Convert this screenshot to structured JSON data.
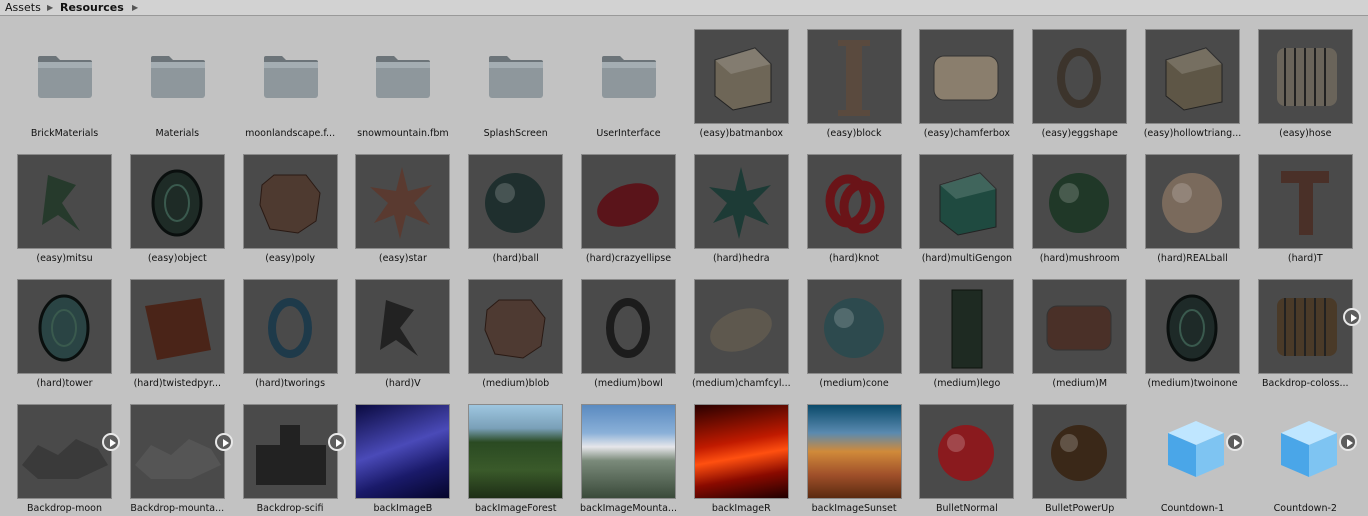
{
  "breadcrumb": {
    "root": "Assets",
    "current": "Resources"
  },
  "rows": [
    [
      {
        "label": "BrickMaterials",
        "kind": "folder"
      },
      {
        "label": "Materials",
        "kind": "folder"
      },
      {
        "label": "moonlandscape.f...",
        "kind": "folder"
      },
      {
        "label": "snowmountain.fbm",
        "kind": "folder"
      },
      {
        "label": "SplashScreen",
        "kind": "folder"
      },
      {
        "label": "UserInterface",
        "kind": "folder"
      },
      {
        "label": "(easy)batmanbox",
        "kind": "model",
        "shape": "box",
        "color": "#6e6657"
      },
      {
        "label": "(easy)block",
        "kind": "model",
        "shape": "ibeam",
        "color": "#5a4a3e"
      },
      {
        "label": "(easy)chamferbox",
        "kind": "model",
        "shape": "slab",
        "color": "#8a7e6d"
      },
      {
        "label": "(easy)eggshape",
        "kind": "model",
        "shape": "ring",
        "color": "#3c342c"
      },
      {
        "label": "(easy)hollowtriang...",
        "kind": "model",
        "shape": "box",
        "color": "#5e5646"
      },
      {
        "label": "(easy)hose",
        "kind": "model",
        "shape": "ribbed",
        "color": "#6a645a"
      }
    ],
    [
      {
        "label": "(easy)mitsu",
        "kind": "model",
        "shape": "tri",
        "color": "#263a2c"
      },
      {
        "label": "(easy)object",
        "kind": "model",
        "shape": "cyl",
        "color": "#1e2b26"
      },
      {
        "label": "(easy)poly",
        "kind": "model",
        "shape": "octa",
        "color": "#4e3a30"
      },
      {
        "label": "(easy)star",
        "kind": "model",
        "shape": "star",
        "color": "#5a3a30"
      },
      {
        "label": "(hard)ball",
        "kind": "model",
        "shape": "sphere",
        "color": "#1f2f2e"
      },
      {
        "label": "(hard)crazyellipse",
        "kind": "model",
        "shape": "ellipse",
        "color": "#5a141a"
      },
      {
        "label": "(hard)hedra",
        "kind": "model",
        "shape": "star",
        "color": "#1d3b36"
      },
      {
        "label": "(hard)knot",
        "kind": "model",
        "shape": "knot",
        "color": "#6a1418"
      },
      {
        "label": "(hard)multiGengon",
        "kind": "model",
        "shape": "box",
        "color": "#1f4a40"
      },
      {
        "label": "(hard)mushroom",
        "kind": "model",
        "shape": "sphere",
        "color": "#203828"
      },
      {
        "label": "(hard)REALball",
        "kind": "model",
        "shape": "sphere",
        "color": "#7a6a5c"
      },
      {
        "label": "(hard)T",
        "kind": "model",
        "shape": "tee",
        "color": "#4a3028"
      }
    ],
    [
      {
        "label": "(hard)tower",
        "kind": "model",
        "shape": "cyl",
        "color": "#2a4444"
      },
      {
        "label": "(hard)twistedpyr...",
        "kind": "model",
        "shape": "sheet",
        "color": "#4a2418"
      },
      {
        "label": "(hard)tworings",
        "kind": "model",
        "shape": "ring",
        "color": "#1e3a4a"
      },
      {
        "label": "(hard)V",
        "kind": "model",
        "shape": "tri",
        "color": "#222"
      },
      {
        "label": "(medium)blob",
        "kind": "model",
        "shape": "octa",
        "color": "#4e3a32"
      },
      {
        "label": "(medium)bowl",
        "kind": "model",
        "shape": "ring",
        "color": "#1c1c1c"
      },
      {
        "label": "(medium)chamfcyl...",
        "kind": "model",
        "shape": "ellipse",
        "color": "#5e584e"
      },
      {
        "label": "(medium)cone",
        "kind": "model",
        "shape": "sphere",
        "color": "#2d4a4e"
      },
      {
        "label": "(medium)lego",
        "kind": "model",
        "shape": "tall",
        "color": "#1e2a22"
      },
      {
        "label": "(medium)M",
        "kind": "model",
        "shape": "slab",
        "color": "#4a3028"
      },
      {
        "label": "(medium)twoinone",
        "kind": "model",
        "shape": "cyl",
        "color": "#1e2a28"
      },
      {
        "label": "Backdrop-coloss...",
        "kind": "model",
        "shape": "ribbed",
        "color": "#4a3a28",
        "play": true
      }
    ],
    [
      {
        "label": "Backdrop-moon",
        "kind": "model",
        "shape": "terrain",
        "color": "#3a3a3a",
        "play": true
      },
      {
        "label": "Backdrop-mounta...",
        "kind": "model",
        "shape": "terrain",
        "color": "#555",
        "play": true
      },
      {
        "label": "Backdrop-scifi",
        "kind": "model",
        "shape": "city",
        "color": "#222",
        "play": true
      },
      {
        "label": "backImageB",
        "kind": "image",
        "bg": "linear-gradient(160deg,#0a0a40,#4a4ab8 45%,#1a1a6a 70%,#05052a)"
      },
      {
        "label": "backImageForest",
        "kind": "image",
        "bg": "linear-gradient(180deg,#9ec6e0 0%,#7aa0b8 25%,#2a4a22 40%,#3a5a2a 70%,#1e2e16 100%)"
      },
      {
        "label": "backImageMounta...",
        "kind": "image",
        "bg": "linear-gradient(180deg,#5a8ac0 0%,#8ab0d8 30%,#e6e6ea 45%,#7a8a7a 60%,#3a4a3a 100%)"
      },
      {
        "label": "backImageR",
        "kind": "image",
        "bg": "linear-gradient(170deg,#2a0000,#c01a00 40%,#ff5010 55%,#8a0a00 75%,#200000)"
      },
      {
        "label": "backImageSunset",
        "kind": "image",
        "bg": "linear-gradient(180deg,#0a4a6a 0%,#5a8ab0 30%,#d08a3a 50%,#a0502a 75%,#5a2a10 100%)"
      },
      {
        "label": "BulletNormal",
        "kind": "model",
        "shape": "ball",
        "color": "#8a1a1e"
      },
      {
        "label": "BulletPowerUp",
        "kind": "model",
        "shape": "ball",
        "color": "#3a2818"
      },
      {
        "label": "Countdown-1",
        "kind": "prefab",
        "play": true
      },
      {
        "label": "Countdown-2",
        "kind": "prefab",
        "play": true
      }
    ]
  ],
  "icons": {
    "folder": "folder-icon",
    "prefab": "prefab-cube-icon",
    "play": "play-icon"
  }
}
